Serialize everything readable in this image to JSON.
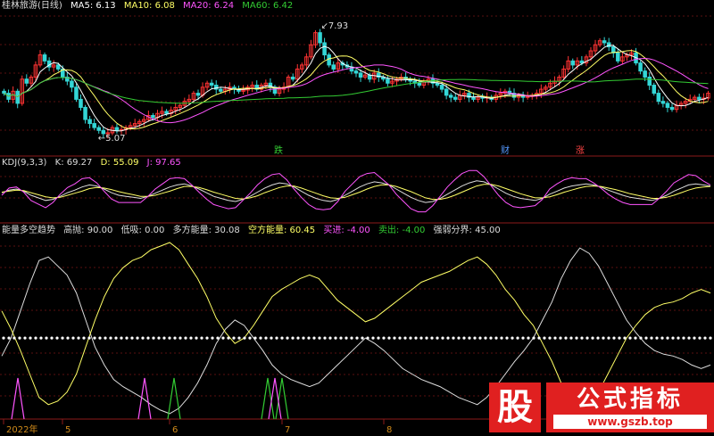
{
  "panels": {
    "price": {
      "name": "桂林旅游(日线)",
      "ma": [
        {
          "label": "MA5: 6.13",
          "color": "#ffffff"
        },
        {
          "label": "MA10: 6.08",
          "color": "#ffff66"
        },
        {
          "label": "MA20: 6.24",
          "color": "#ff55ff"
        },
        {
          "label": "MA60: 6.42",
          "color": "#33cc33"
        }
      ],
      "high_label": "7.93",
      "low_label": "5.07",
      "event_marks": [
        {
          "text": "跌",
          "color": "#33cc33"
        },
        {
          "text": "财",
          "color": "#5599ff"
        },
        {
          "text": "涨",
          "color": "#ff4444"
        }
      ]
    },
    "kdj": {
      "name": "KDJ(9,3,3)",
      "items": [
        {
          "label": "K: 69.27",
          "color": "#dddddd"
        },
        {
          "label": "D: 55.09",
          "color": "#ffff66"
        },
        {
          "label": "J: 97.65",
          "color": "#ff55ff"
        }
      ]
    },
    "energy": {
      "name": "能量多空趋势",
      "items": [
        {
          "label": "高抛: 90.00",
          "color": "#dddddd"
        },
        {
          "label": "低吸: 0.00",
          "color": "#dddddd"
        },
        {
          "label": "多方能量: 30.08",
          "color": "#dddddd"
        },
        {
          "label": "空方能量: 60.45",
          "color": "#ffff66"
        },
        {
          "label": "买进: -4.00",
          "color": "#ff55ff"
        },
        {
          "label": "卖出: -4.00",
          "color": "#33cc33"
        },
        {
          "label": "强弱分界: 45.00",
          "color": "#dddddd"
        }
      ]
    }
  },
  "xaxis": {
    "ticks": [
      "2022年",
      "5",
      "6",
      "7",
      "8"
    ]
  },
  "watermark": {
    "big": "股",
    "title": "公式指标",
    "url": "www.gszb.top"
  },
  "chart_data": [
    {
      "type": "candlestick",
      "title": "桂林旅游(日线)",
      "series": [
        {
          "name": "MA5",
          "color": "#ffffff"
        },
        {
          "name": "MA10",
          "color": "#ffff66"
        },
        {
          "name": "MA20",
          "color": "#ff55ff"
        },
        {
          "name": "MA60",
          "color": "#33cc33"
        }
      ],
      "close": [
        6.2,
        6.05,
        6.25,
        5.95,
        6.55,
        6.45,
        6.6,
        6.9,
        7.15,
        7.0,
        6.85,
        6.9,
        6.8,
        6.6,
        6.5,
        6.35,
        6.05,
        5.85,
        5.55,
        5.45,
        5.35,
        5.28,
        5.2,
        5.22,
        5.35,
        5.28,
        5.3,
        5.35,
        5.4,
        5.45,
        5.5,
        5.55,
        5.65,
        5.6,
        5.7,
        5.75,
        5.7,
        5.78,
        5.85,
        5.9,
        6.0,
        6.05,
        6.2,
        6.15,
        6.35,
        6.45,
        6.4,
        6.3,
        6.25,
        6.3,
        6.35,
        6.3,
        6.25,
        6.28,
        6.35,
        6.4,
        6.3,
        6.4,
        6.45,
        6.35,
        6.2,
        6.3,
        6.35,
        6.6,
        6.55,
        6.8,
        6.9,
        7.1,
        7.4,
        7.7,
        7.45,
        7.15,
        6.9,
        6.8,
        6.95,
        6.9,
        6.85,
        6.75,
        6.7,
        6.6,
        6.65,
        6.55,
        6.7,
        6.6,
        6.55,
        6.45,
        6.5,
        6.55,
        6.6,
        6.55,
        6.5,
        6.45,
        6.4,
        6.5,
        6.55,
        6.45,
        6.4,
        6.3,
        6.15,
        6.1,
        6.05,
        6.15,
        6.2,
        6.1,
        6.05,
        6.1,
        6.08,
        6.1,
        6.05,
        6.15,
        6.2,
        6.25,
        6.2,
        6.1,
        6.15,
        6.1,
        6.12,
        6.15,
        6.2,
        6.3,
        6.35,
        6.45,
        6.5,
        6.6,
        6.8,
        7.0,
        6.9,
        7.0,
        6.95,
        7.1,
        7.25,
        7.4,
        7.5,
        7.45,
        7.35,
        7.2,
        7.0,
        7.1,
        7.15,
        7.2,
        6.95,
        6.75,
        6.6,
        6.4,
        6.2,
        6.0,
        5.95,
        5.85,
        5.8,
        5.9,
        5.95,
        6.0,
        6.05,
        6.1,
        6.05,
        6.08,
        6.2
      ],
      "high": 7.93,
      "low": 5.07,
      "ylim": [
        4.8,
        8.2
      ]
    },
    {
      "type": "line",
      "title": "KDJ(9,3,3)",
      "series": [
        {
          "name": "K",
          "color": "#dddddd",
          "values": [
            55,
            60,
            62,
            58,
            50,
            45,
            40,
            42,
            48,
            55,
            60,
            66,
            70,
            68,
            62,
            55,
            50,
            48,
            46,
            44,
            48,
            54,
            60,
            66,
            70,
            72,
            68,
            62,
            55,
            48,
            44,
            40,
            38,
            42,
            48,
            56,
            64,
            70,
            74,
            72,
            66,
            58,
            50,
            44,
            40,
            38,
            42,
            50,
            58,
            66,
            72,
            76,
            74,
            70,
            62,
            54,
            46,
            40,
            36,
            38,
            44,
            52,
            60,
            68,
            74,
            78,
            76,
            70,
            62,
            54,
            48,
            44,
            42,
            40,
            44,
            52,
            58,
            64,
            68,
            70,
            72,
            70,
            66,
            60,
            55,
            50,
            46,
            44,
            42,
            40,
            44,
            50,
            58,
            64,
            70,
            72,
            70,
            68
          ]
        },
        {
          "name": "D",
          "color": "#ffff66",
          "values": [
            56,
            58,
            60,
            59,
            55,
            51,
            47,
            45,
            46,
            50,
            54,
            58,
            63,
            65,
            64,
            61,
            57,
            54,
            51,
            48,
            48,
            50,
            54,
            58,
            63,
            67,
            67,
            65,
            61,
            56,
            52,
            48,
            44,
            43,
            45,
            49,
            55,
            60,
            65,
            68,
            68,
            64,
            59,
            54,
            49,
            45,
            44,
            46,
            51,
            56,
            62,
            67,
            70,
            70,
            67,
            62,
            57,
            51,
            45,
            42,
            42,
            45,
            50,
            56,
            62,
            68,
            71,
            71,
            68,
            63,
            58,
            53,
            49,
            45,
            45,
            47,
            51,
            56,
            60,
            64,
            67,
            68,
            67,
            64,
            61,
            57,
            53,
            50,
            47,
            44,
            44,
            46,
            50,
            55,
            60,
            64,
            66,
            67
          ]
        },
        {
          "name": "J",
          "color": "#ff55ff",
          "values": [
            50,
            64,
            66,
            56,
            40,
            33,
            26,
            36,
            52,
            65,
            72,
            82,
            84,
            74,
            58,
            43,
            36,
            36,
            36,
            36,
            48,
            62,
            72,
            82,
            84,
            82,
            70,
            56,
            43,
            32,
            28,
            24,
            26,
            40,
            54,
            70,
            82,
            90,
            92,
            80,
            62,
            46,
            32,
            24,
            22,
            24,
            38,
            58,
            72,
            86,
            92,
            94,
            82,
            70,
            52,
            38,
            24,
            18,
            18,
            30,
            48,
            66,
            80,
            92,
            98,
            98,
            86,
            68,
            50,
            36,
            28,
            26,
            28,
            30,
            42,
            62,
            72,
            80,
            84,
            82,
            82,
            74,
            64,
            52,
            43,
            36,
            32,
            32,
            32,
            32,
            44,
            58,
            74,
            82,
            90,
            88,
            78,
            70
          ]
        }
      ]
    },
    {
      "type": "line",
      "title": "能量多空趋势",
      "series": [
        {
          "name": "多方能量",
          "color": "#dddddd",
          "values": [
            35,
            45,
            60,
            75,
            88,
            90,
            85,
            80,
            70,
            55,
            40,
            30,
            22,
            18,
            15,
            12,
            8,
            5,
            3,
            6,
            12,
            20,
            30,
            42,
            50,
            55,
            52,
            45,
            38,
            30,
            25,
            22,
            20,
            18,
            20,
            25,
            30,
            35,
            40,
            45,
            42,
            38,
            33,
            28,
            25,
            22,
            20,
            18,
            15,
            12,
            10,
            8,
            12,
            18,
            25,
            32,
            38,
            45,
            55,
            65,
            78,
            88,
            95,
            92,
            85,
            75,
            65,
            55,
            48,
            42,
            38,
            36,
            35,
            33,
            30,
            28,
            30
          ]
        },
        {
          "name": "空方能量",
          "color": "#ffff66",
          "values": [
            60,
            50,
            38,
            25,
            12,
            8,
            10,
            15,
            25,
            40,
            55,
            68,
            78,
            84,
            88,
            90,
            94,
            96,
            98,
            94,
            86,
            78,
            68,
            56,
            48,
            42,
            45,
            52,
            60,
            68,
            72,
            75,
            78,
            80,
            78,
            72,
            66,
            62,
            58,
            54,
            56,
            60,
            64,
            68,
            72,
            76,
            78,
            80,
            82,
            85,
            88,
            90,
            86,
            80,
            72,
            66,
            58,
            52,
            42,
            32,
            20,
            10,
            5,
            8,
            15,
            25,
            35,
            45,
            52,
            58,
            62,
            64,
            65,
            67,
            70,
            72,
            70
          ]
        },
        {
          "name": "强弱分界",
          "color": "#dddddd",
          "values": [
            45
          ]
        },
        {
          "name": "买进",
          "color": "#ff55ff"
        },
        {
          "name": "卖出",
          "color": "#33cc33"
        }
      ],
      "levels": {
        "高抛": 90.0,
        "低吸": 0.0,
        "强弱分界": 45.0
      }
    }
  ]
}
